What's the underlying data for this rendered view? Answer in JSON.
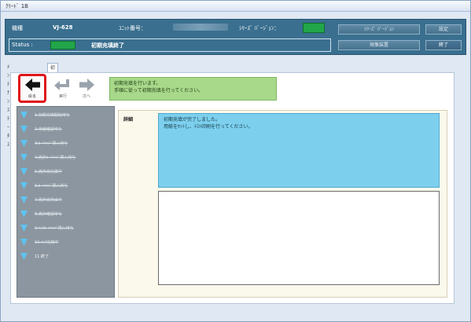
{
  "window": {
    "title": "ｸﾘｰﾄﾞ 1B"
  },
  "header": {
    "model_label": "機種",
    "model_value": "VJ-628",
    "unit_label": "ﾕﾆｯﾄ番号：",
    "serial_label": "ｼﾘｰｽﾞ ﾊﾞｰｼﾞｮﾝ：",
    "status_label": "Status :",
    "status_value": "初期充填終了",
    "buttons": {
      "top_left": "ｼﾘｰｽﾞ ﾊﾞｰｼﾞｮﾝ",
      "top_right": "設定",
      "bottom_left": "現像装置",
      "bottom_right": "終了"
    },
    "colors": {
      "header_bg": "#3a6f8f",
      "indicator_green": "#22a64a"
    }
  },
  "tabs": [
    {
      "label": "ﾒﾝﾃﾅﾝｽﾃｰﾀｽ"
    },
    {
      "label": "初期充填"
    }
  ],
  "toolbar": {
    "back_label": "戻る",
    "button2_label": "実行",
    "button3_label": "次へ",
    "back_icon": "arrow-left-icon",
    "colors": {
      "highlight": "#e0151b"
    }
  },
  "message": {
    "line1": "初期充填を行います。",
    "line2": "手順に従って初期充填を行ってください。"
  },
  "steps": [
    {
      "label": "1.初期充填開始待ち",
      "state": "done"
    },
    {
      "label": "2.用紙確認待ち",
      "state": "done"
    },
    {
      "label": "3.ｶｰﾄﾘｯｼﾞ挿入待ち",
      "state": "done"
    },
    {
      "label": "4.洗浄ｶｰﾄﾘｯｼﾞ挿入待ち",
      "state": "done"
    },
    {
      "label": "5.洗浄液充填中",
      "state": "done"
    },
    {
      "label": "6.ｶｰﾄﾘｯｼﾞ挿入待ち",
      "state": "done"
    },
    {
      "label": "7.洗浄液排出中",
      "state": "done"
    },
    {
      "label": "8.洗浄確認待ち",
      "state": "done"
    },
    {
      "label": "9.ｲﾝｸｶｰﾄﾘｯｼﾞ挿入待ち",
      "state": "done"
    },
    {
      "label": "10.ｲﾝｸ充填中",
      "state": "done"
    },
    {
      "label": "11.終了",
      "state": "current"
    }
  ],
  "detail": {
    "label": "詳細",
    "line1": "初期充填が完了しました。",
    "line2": "用紙をｾｯﾄし、ﾃｽﾄ印刷を行ってください。"
  }
}
